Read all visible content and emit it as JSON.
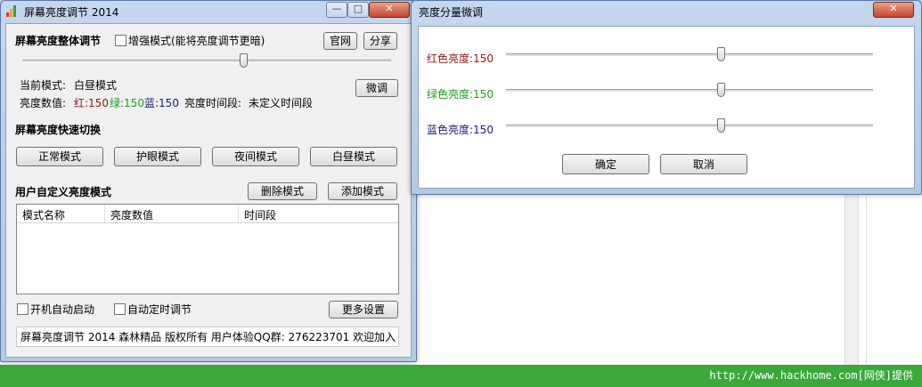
{
  "main_window": {
    "title": "屏幕亮度调节 2014",
    "section_overall": "屏幕亮度整体调节",
    "enhanced_mode_label": "增强模式(能将亮度调节更暗)",
    "official_site_btn": "官网",
    "share_btn": "分享",
    "overall_brightness": 0.6,
    "current_mode_label": "当前模式:",
    "current_mode_value": "白昼模式",
    "fine_tune_btn": "微调",
    "brightness_value_label": "亮度数值:",
    "red_text": "红:150",
    "green_text": "绿:150",
    "blue_text": "蓝:150",
    "period_label": "亮度时间段:",
    "period_value": "未定义时间段",
    "section_quick": "屏幕亮度快速切换",
    "quick_modes": [
      "正常模式",
      "护眼模式",
      "夜间模式",
      "白昼模式"
    ],
    "section_custom": "用户自定义亮度模式",
    "delete_mode_btn": "删除模式",
    "add_mode_btn": "添加模式",
    "columns": [
      "模式名称",
      "亮度数值",
      "时间段"
    ],
    "autostart_label": "开机自动启动",
    "auto_timing_label": "自动定时调节",
    "more_settings_btn": "更多设置",
    "status_text": "屏幕亮度调节 2014 森林精品 版权所有 用户体验QQ群: 276223701 欢迎加入"
  },
  "dialog": {
    "title": "亮度分量微调",
    "red_label": "红色亮度:",
    "red_value": "150",
    "green_label": "绿色亮度:",
    "green_value": "150",
    "blue_label": "蓝色亮度:",
    "blue_value": "150",
    "ok_btn": "确定",
    "cancel_btn": "取消",
    "red_color": "#8b1a1a",
    "green_color": "#1e9e1e",
    "blue_color": "#1a1a7a"
  },
  "footer": {
    "text": "http://www.hackhome.com[网侠]提供"
  }
}
